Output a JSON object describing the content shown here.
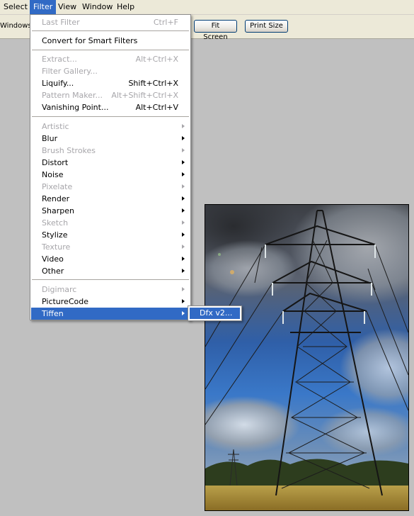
{
  "menubar": {
    "items": [
      "Select",
      "Filter",
      "View",
      "Window",
      "Help"
    ],
    "active_index": 1
  },
  "options_bar": {
    "label": "Windows",
    "fit_screen": "Fit Screen",
    "print_size": "Print Size"
  },
  "filter_menu": {
    "items": [
      {
        "label": "Last Filter",
        "shortcut": "Ctrl+F",
        "disabled": true
      },
      {
        "label": "Convert for Smart Filters"
      },
      {
        "label": "Extract...",
        "shortcut": "Alt+Ctrl+X",
        "disabled": true
      },
      {
        "label": "Filter Gallery...",
        "disabled": true
      },
      {
        "label": "Liquify...",
        "shortcut": "Shift+Ctrl+X"
      },
      {
        "label": "Pattern Maker...",
        "shortcut": "Alt+Shift+Ctrl+X",
        "disabled": true
      },
      {
        "label": "Vanishing Point...",
        "shortcut": "Alt+Ctrl+V"
      },
      {
        "label": "Artistic",
        "submenu": true,
        "disabled": true
      },
      {
        "label": "Blur",
        "submenu": true
      },
      {
        "label": "Brush Strokes",
        "submenu": true,
        "disabled": true
      },
      {
        "label": "Distort",
        "submenu": true
      },
      {
        "label": "Noise",
        "submenu": true
      },
      {
        "label": "Pixelate",
        "submenu": true,
        "disabled": true
      },
      {
        "label": "Render",
        "submenu": true
      },
      {
        "label": "Sharpen",
        "submenu": true
      },
      {
        "label": "Sketch",
        "submenu": true,
        "disabled": true
      },
      {
        "label": "Stylize",
        "submenu": true
      },
      {
        "label": "Texture",
        "submenu": true,
        "disabled": true
      },
      {
        "label": "Video",
        "submenu": true
      },
      {
        "label": "Other",
        "submenu": true
      },
      {
        "label": "Digimarc",
        "submenu": true,
        "disabled": true
      },
      {
        "label": "PictureCode",
        "submenu": true
      },
      {
        "label": "Tiffen",
        "submenu": true,
        "highlighted": true
      }
    ]
  },
  "tiffen_submenu": {
    "items": [
      {
        "label": "Dfx v2..."
      }
    ]
  },
  "colors": {
    "menu_highlight": "#316ac5",
    "disabled_text": "#a7a6aa",
    "workspace": "#c0c0c0"
  }
}
